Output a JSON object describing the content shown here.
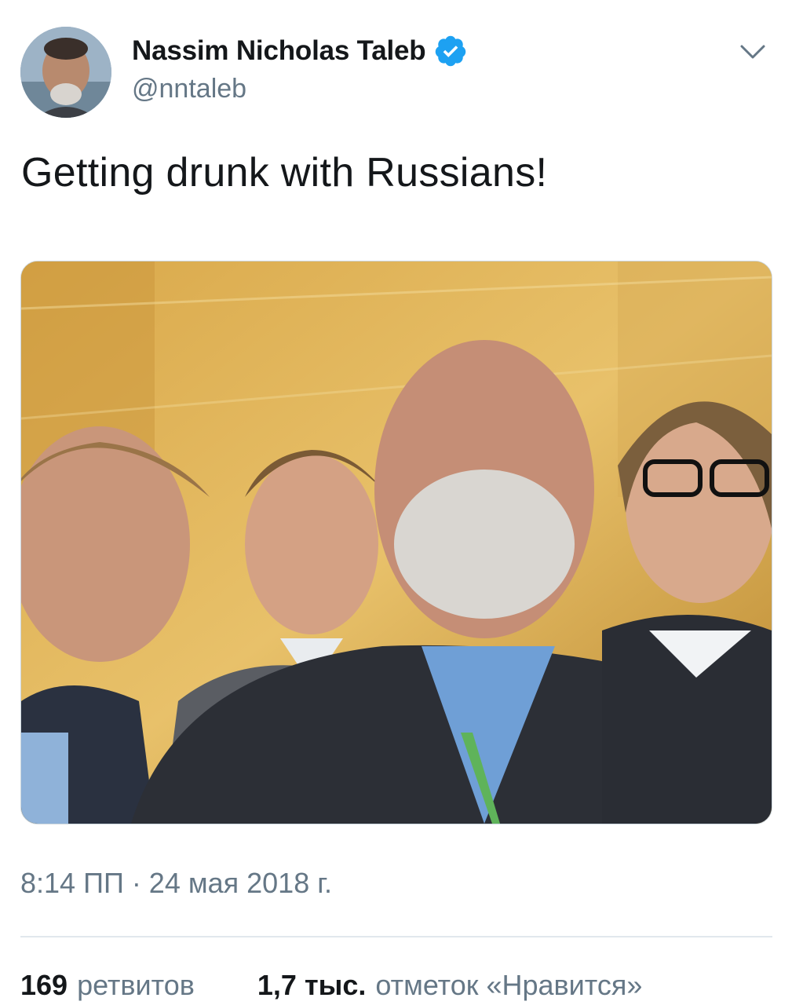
{
  "tweet": {
    "author": {
      "name": "Nassim Nicholas Taleb",
      "handle": "@nntaleb",
      "verified": true
    },
    "text": "Getting drunk with Russians!",
    "media": {
      "type": "photo",
      "description_icon": "photo-icon"
    },
    "timestamp": "8:14 ПП · 24 мая 2018 г.",
    "stats": {
      "retweets_count": "169",
      "retweets_label": "ретвитов",
      "likes_count": "1,7 тыс.",
      "likes_label": "отметок «Нравится»"
    }
  },
  "colors": {
    "verified_blue": "#1da1f2",
    "secondary_text": "#657786",
    "primary_text": "#14171a",
    "divider": "#e1e8ed"
  },
  "icons": {
    "verified": "verified-badge-icon",
    "menu": "chevron-down-icon"
  }
}
